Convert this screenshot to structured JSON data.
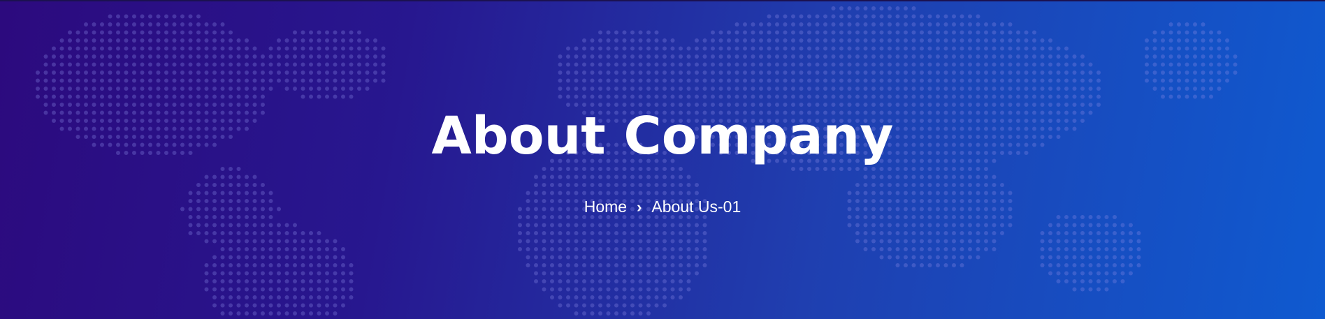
{
  "hero": {
    "title": "About Company",
    "background_colors": [
      "#2c0a7e",
      "#27178f",
      "#1f3fb0",
      "#0f5ad0"
    ],
    "dot_color": "#8a88e6"
  },
  "breadcrumb": {
    "items": [
      {
        "label": "Home"
      },
      {
        "label": "About Us-01"
      }
    ],
    "separator": "›"
  }
}
